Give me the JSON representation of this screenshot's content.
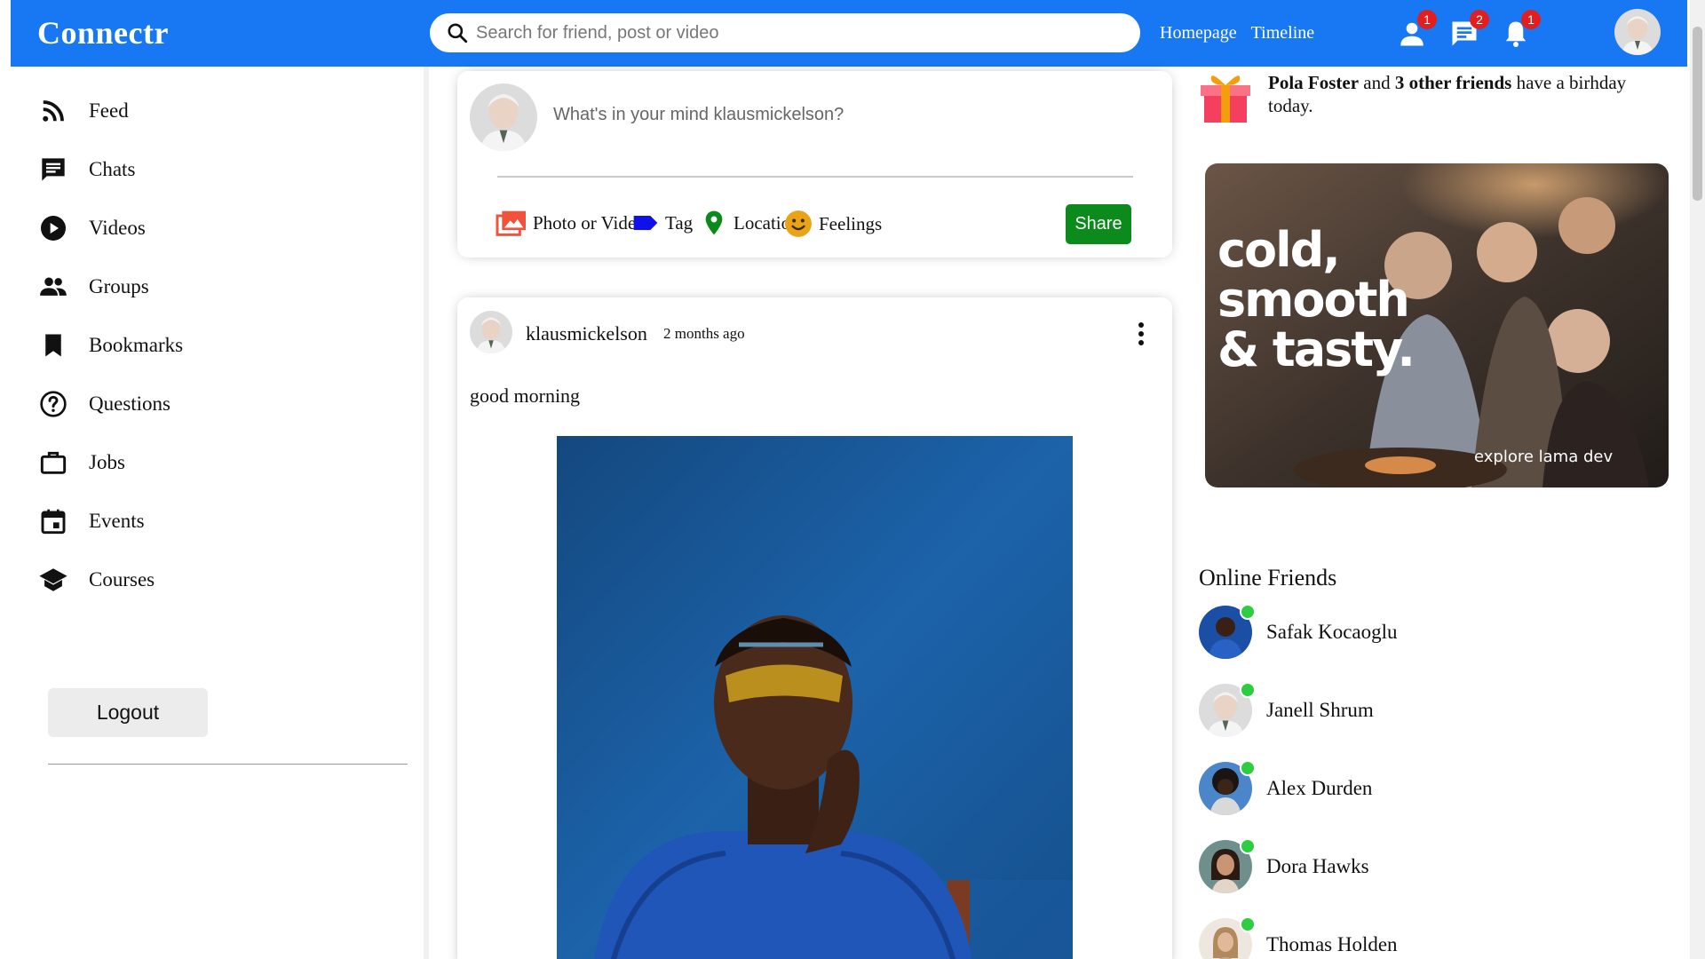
{
  "topbar": {
    "logo": "Connectr",
    "search_placeholder": "Search for friend, post or video",
    "links": {
      "homepage": "Homepage",
      "timeline": "Timeline"
    },
    "badges": {
      "friend_requests": "1",
      "messages": "2",
      "notifications": "1"
    },
    "color": "#1877f2"
  },
  "sidebar": {
    "items": [
      {
        "label": "Feed",
        "icon": "rss-icon"
      },
      {
        "label": "Chats",
        "icon": "chat-icon"
      },
      {
        "label": "Videos",
        "icon": "play-circle-icon"
      },
      {
        "label": "Groups",
        "icon": "group-icon"
      },
      {
        "label": "Bookmarks",
        "icon": "bookmark-icon"
      },
      {
        "label": "Questions",
        "icon": "help-circle-icon"
      },
      {
        "label": "Jobs",
        "icon": "briefcase-icon"
      },
      {
        "label": "Events",
        "icon": "calendar-icon"
      },
      {
        "label": "Courses",
        "icon": "school-icon"
      }
    ],
    "logout": "Logout"
  },
  "share": {
    "placeholder": "What's in your mind klausmickelson?",
    "options": {
      "photo": "Photo or Video",
      "tag": "Tag",
      "location": "Location",
      "feelings": "Feelings"
    },
    "share_button": "Share",
    "share_color": "#0c8a1c"
  },
  "post": {
    "username": "klausmickelson",
    "date": "2 months ago",
    "text": "good morning"
  },
  "rightbar": {
    "birthday": {
      "name": "Pola Foster",
      "middle": " and ",
      "others": "3 other friends",
      "suffix": " have a birhday today."
    },
    "ad": {
      "title_line1": "cold,",
      "title_line2": "smooth",
      "title_line3": "& tasty.",
      "footer": "explore lama dev"
    },
    "online_title": "Online Friends",
    "friends": [
      {
        "name": "Safak Kocaoglu"
      },
      {
        "name": "Janell Shrum"
      },
      {
        "name": "Alex Durden"
      },
      {
        "name": "Dora Hawks"
      },
      {
        "name": "Thomas Holden"
      }
    ],
    "online_color": "#2ecc40"
  }
}
